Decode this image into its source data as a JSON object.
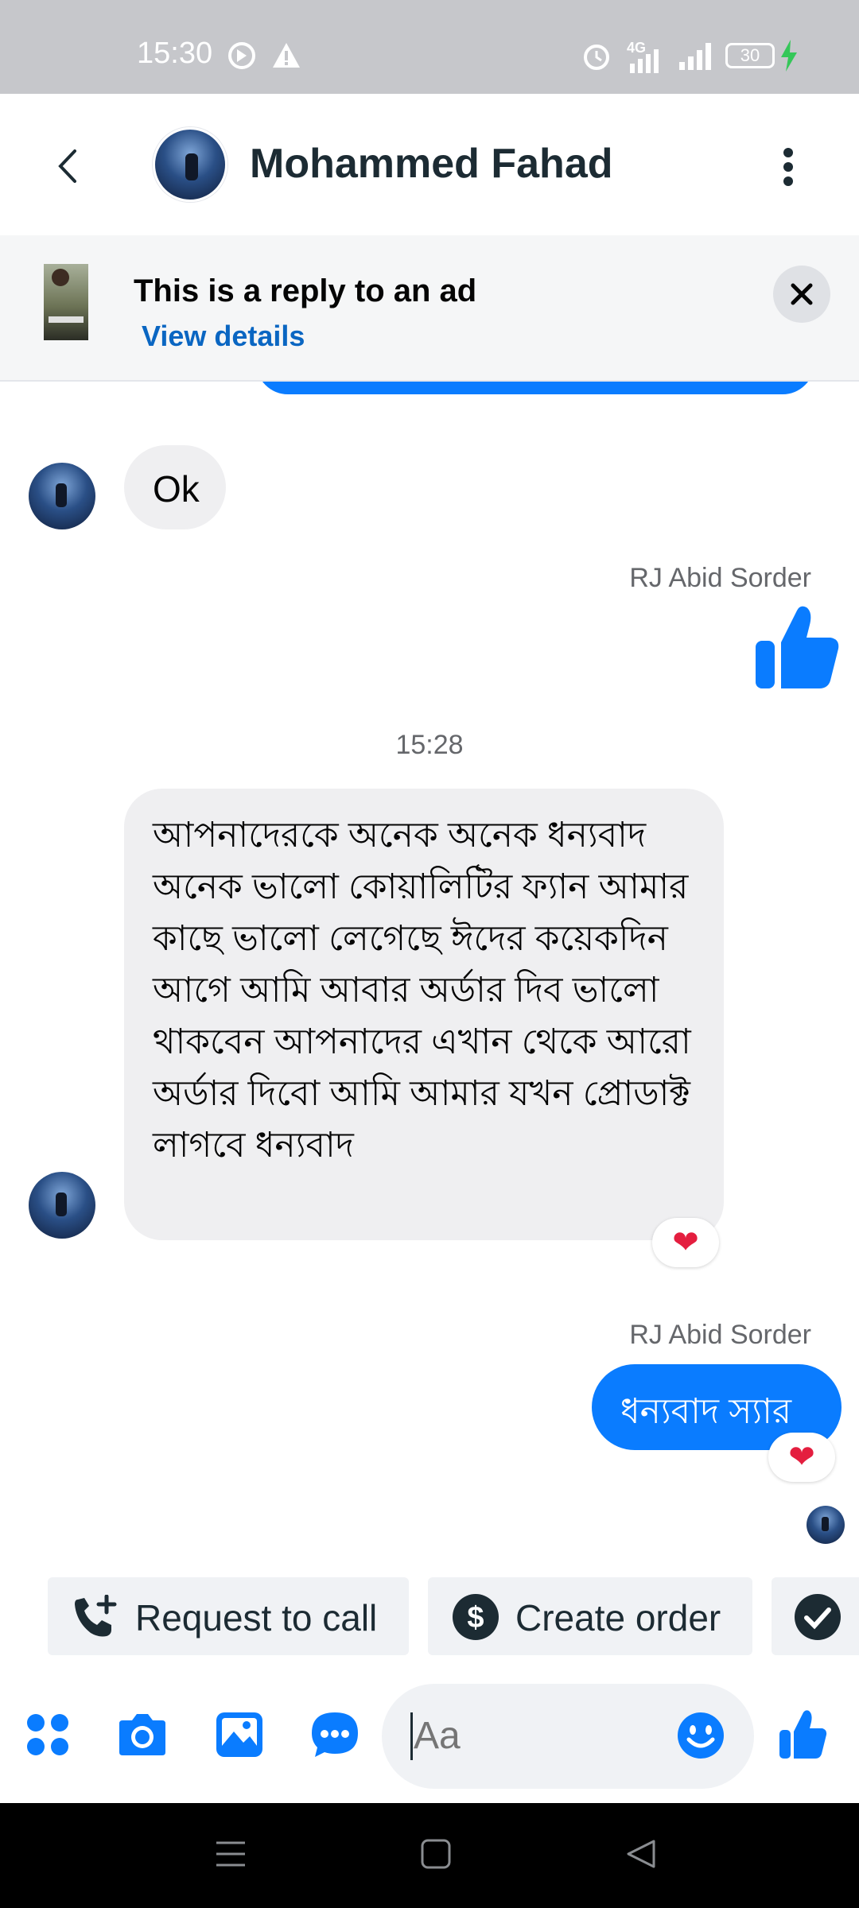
{
  "status_bar": {
    "time": "15:30",
    "network": "4G",
    "battery": "30"
  },
  "header": {
    "title": "Mohammed Fahad"
  },
  "ad_banner": {
    "title": "This is a reply to an ad",
    "link": "View details"
  },
  "messages": {
    "ok": "Ok",
    "sender_1": "RJ Abid Sorder",
    "timestamp": "15:28",
    "long_text": "আপনাদেরকে অনেক অনেক ধন্যবাদ অনেক ভালো কোয়ালিটির ফ্যান আমার কাছে ভালো লেগেছে ঈদের কয়েকদিন আগে আমি আবার অর্ডার দিব ভালো থাকবেন আপনাদের এখান থেকে আরো অর্ডার দিবো আমি আমার যখন প্রোডাক্ট লাগবে ধন্যবাদ",
    "sender_2": "RJ Abid Sorder",
    "reply_text": "ধন্যবাদ স্যার"
  },
  "quick_replies": {
    "request_call": "Request to call",
    "create_order": "Create order"
  },
  "composer": {
    "placeholder": "Aa"
  },
  "colors": {
    "accent": "#0a7cff",
    "link": "#0a66c2",
    "incoming_bubble": "#efeff1",
    "reaction_heart": "#e41e3f"
  }
}
